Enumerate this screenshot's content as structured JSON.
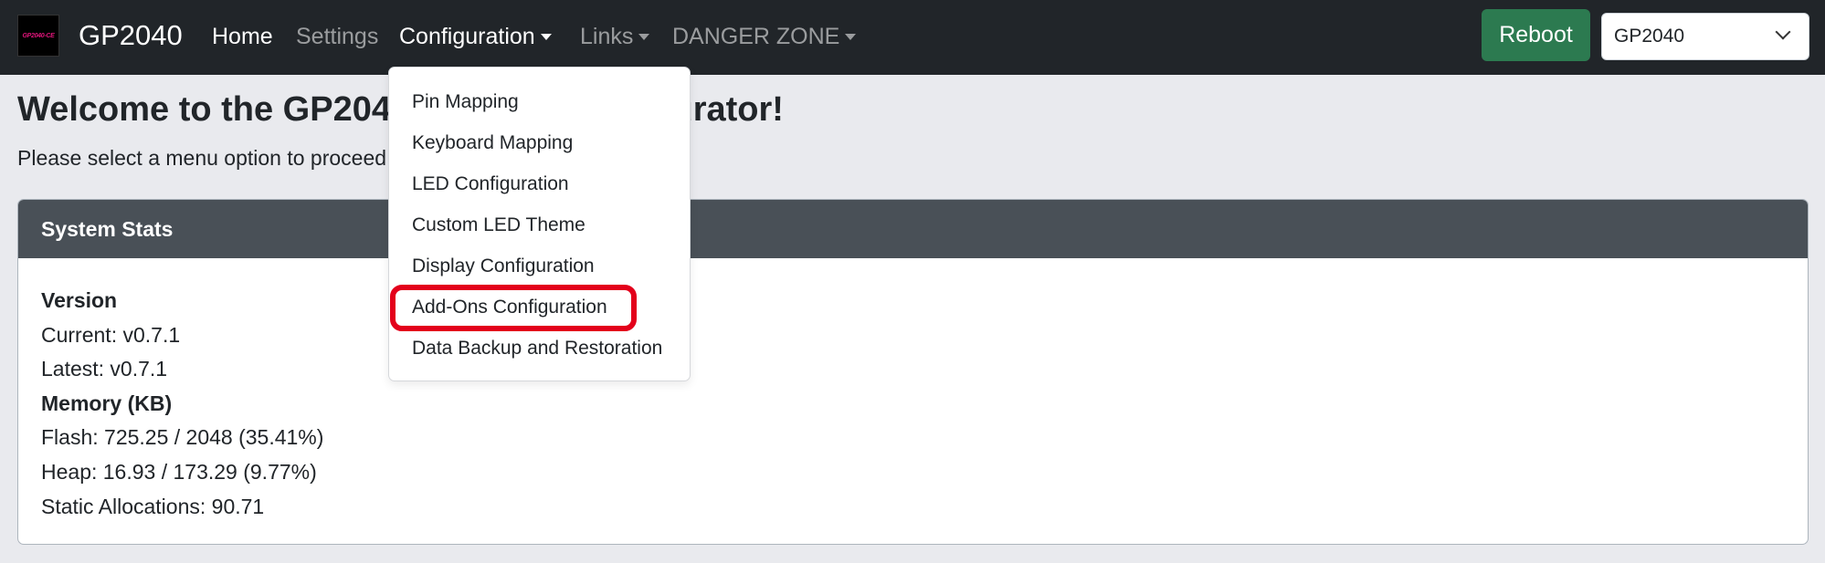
{
  "navbar": {
    "logo_text": "GP2040-CE",
    "brand": "GP2040",
    "links": [
      {
        "label": "Home",
        "active": true,
        "dropdown": false
      },
      {
        "label": "Settings",
        "active": false,
        "dropdown": false
      },
      {
        "label": "Configuration",
        "active": true,
        "dropdown": true
      },
      {
        "label": "Links",
        "active": false,
        "dropdown": true
      },
      {
        "label": "DANGER ZONE",
        "active": false,
        "dropdown": true
      }
    ],
    "reboot_label": "Reboot",
    "board_select_value": "GP2040"
  },
  "configuration_menu": {
    "items": [
      "Pin Mapping",
      "Keyboard Mapping",
      "LED Configuration",
      "Custom LED Theme",
      "Display Configuration",
      "Add-Ons Configuration",
      "Data Backup and Restoration"
    ],
    "highlighted_item": "Add-Ons Configuration"
  },
  "main": {
    "welcome_title": "Welcome to the GP2040-CE Web Configurator!",
    "subtitle": "Please select a menu option to proceed."
  },
  "system_stats": {
    "header": "System Stats",
    "version_heading": "Version",
    "current": "Current: v0.7.1",
    "latest": "Latest: v0.7.1",
    "memory_heading": "Memory (KB)",
    "flash": "Flash: 725.25 / 2048 (35.41%)",
    "heap": "Heap: 16.93 / 173.29 (9.77%)",
    "static_allocations": "Static Allocations: 90.71"
  },
  "colors": {
    "navbar_bg": "#212529",
    "reboot_button": "#2c7a50",
    "card_header_bg": "#495057",
    "highlight_border": "#e3001b",
    "page_bg": "#e9eaee"
  }
}
